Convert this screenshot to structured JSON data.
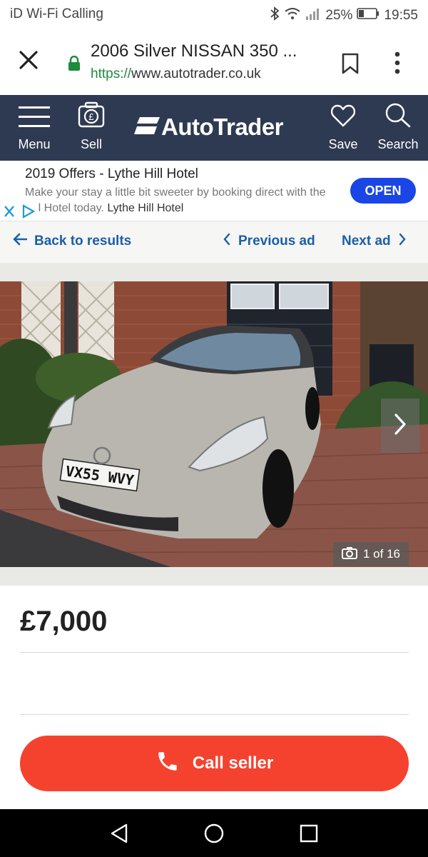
{
  "status_bar": {
    "carrier": "iD Wi-Fi Calling",
    "battery": "25%",
    "time": "19:55"
  },
  "browser": {
    "page_title": "2006 Silver NISSAN 350 ...",
    "url_scheme": "https://",
    "url_host": "www.autotrader.co.uk"
  },
  "header": {
    "menu_label": "Menu",
    "sell_label": "Sell",
    "logo_text": "AutoTrader",
    "save_label": "Save",
    "search_label": "Search"
  },
  "ad": {
    "title": "2019 Offers - Lythe Hill Hotel",
    "body": "Make your stay a little bit sweeter by booking direct with the Hill Hotel today.",
    "advertiser": "Lythe Hill Hotel",
    "cta": "OPEN"
  },
  "nav": {
    "back": "Back to results",
    "previous": "Previous ad",
    "next": "Next ad"
  },
  "gallery": {
    "count_label": "1 of 16",
    "plate": "VX55 WVY"
  },
  "listing": {
    "price": "£7,000",
    "call_label": "Call seller"
  },
  "colors": {
    "brand_navy": "#2e3a52",
    "link_blue": "#1c5ea8",
    "call_red": "#f5422f",
    "ad_blue": "#1a46e6"
  }
}
